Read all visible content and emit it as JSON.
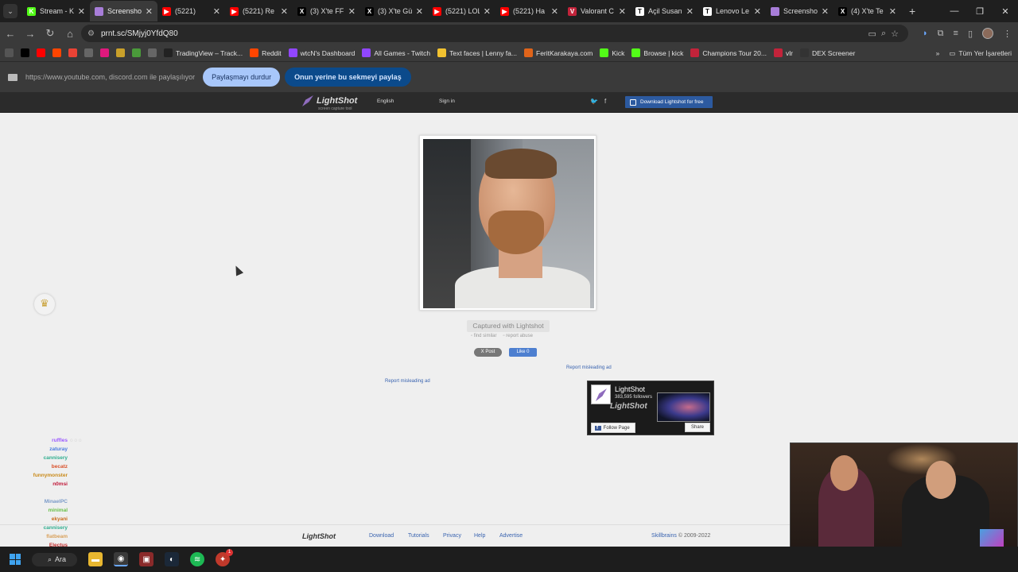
{
  "tabs": [
    {
      "label": "Stream - K",
      "icon_text": "K",
      "color": "#53fc18",
      "active": false
    },
    {
      "label": "Screensho",
      "icon_text": "",
      "color": "#a77dd8",
      "active": true
    },
    {
      "label": "(5221)",
      "icon_text": "▶",
      "color": "#ff0000",
      "active": false
    },
    {
      "label": "(5221) Re",
      "icon_text": "▶",
      "color": "#ff0000",
      "active": false
    },
    {
      "label": "(3) X'te FF",
      "icon_text": "X",
      "color": "#000000",
      "active": false
    },
    {
      "label": "(3) X'te Gü",
      "icon_text": "X",
      "color": "#000000",
      "active": false
    },
    {
      "label": "(5221) LOL",
      "icon_text": "▶",
      "color": "#ff0000",
      "active": false
    },
    {
      "label": "(5221) Ha",
      "icon_text": "▶",
      "color": "#ff0000",
      "active": false
    },
    {
      "label": "Valorant C",
      "icon_text": "V",
      "color": "#c2233a",
      "active": false
    },
    {
      "label": "Açil Susan",
      "icon_text": "T",
      "color": "#ffffff",
      "active": false
    },
    {
      "label": "Lenovo Le",
      "icon_text": "T",
      "color": "#ffffff",
      "active": false
    },
    {
      "label": "Screensho",
      "icon_text": "",
      "color": "#a77dd8",
      "active": false
    },
    {
      "label": "(4) X'te Te",
      "icon_text": "X",
      "color": "#000000",
      "active": false
    }
  ],
  "address": {
    "url": "prnt.sc/SMjyj0YfdQ80"
  },
  "bookmarks": [
    {
      "label": "",
      "icon": "apps-icon",
      "color": "#555"
    },
    {
      "label": "",
      "icon": "x-icon",
      "color": "#000"
    },
    {
      "label": "",
      "icon": "youtube-icon",
      "color": "#ff0000"
    },
    {
      "label": "",
      "icon": "reddit-icon",
      "color": "#ff4500"
    },
    {
      "label": "",
      "icon": "gmail-icon",
      "color": "#ea4335"
    },
    {
      "label": "",
      "icon": "globe-icon",
      "color": "#666"
    },
    {
      "label": "",
      "icon": "y-icon",
      "color": "#e0197d"
    },
    {
      "label": "",
      "icon": "g-icon",
      "color": "#c9a02a"
    },
    {
      "label": "",
      "icon": "frog-icon",
      "color": "#4a9a3a"
    },
    {
      "label": "",
      "icon": "globe-icon",
      "color": "#666"
    },
    {
      "label": "TradingView – Track...",
      "icon": "tradingview-icon",
      "color": "#222"
    },
    {
      "label": "Reddit",
      "icon": "reddit-icon",
      "color": "#ff4500"
    },
    {
      "label": "wtcN's Dashboard",
      "icon": "twitch-icon",
      "color": "#9146ff"
    },
    {
      "label": "All Games - Twitch",
      "icon": "twitch-icon",
      "color": "#9146ff"
    },
    {
      "label": "Text faces | Lenny fa...",
      "icon": "smile-icon",
      "color": "#f2c230"
    },
    {
      "label": "FeritKarakaya.com",
      "icon": "fk-icon",
      "color": "#e0641a"
    },
    {
      "label": "Kick",
      "icon": "kick-icon",
      "color": "#53fc18"
    },
    {
      "label": "Browse | kick",
      "icon": "kick-icon",
      "color": "#53fc18"
    },
    {
      "label": "Champions Tour 20...",
      "icon": "valorant-icon",
      "color": "#c2233a"
    },
    {
      "label": "vlr",
      "icon": "valorant-icon",
      "color": "#c2233a"
    },
    {
      "label": "DEX Screener",
      "icon": "dex-icon",
      "color": "#333"
    }
  ],
  "bookmarks_all": "Tüm Yer İşaretleri",
  "sharebar": {
    "text": "https://www.youtube.com, discord.com ile paylaşılıyor",
    "stop_button": "Paylaşmayı durdur",
    "share_tab_button": "Onun yerine bu sekmeyi paylaş"
  },
  "lightshot": {
    "logo": "LightShot",
    "tagline": "screen capture tool",
    "language": "English",
    "signin": "Sign in",
    "download_button": "Download Lightshot for free",
    "captured": "Captured with Lightshot",
    "find_similar": "find similar",
    "report_abuse": "report abuse",
    "post": "X Post",
    "like": "Like 0",
    "report_ad_1": "Report misleading ad",
    "report_ad_2": "Report misleading ad"
  },
  "fb_widget": {
    "title": "LightShot",
    "followers": "383,595 followers",
    "follow": "Follow Page",
    "share": "Share",
    "logo_text": "LightShot"
  },
  "footer": {
    "logo": "LightShot",
    "links": [
      "Download",
      "Tutorials",
      "Privacy",
      "Help",
      "Advertise"
    ],
    "company": "Skillbrains",
    "copyright": "© 2009-2022"
  },
  "chat": [
    {
      "user": "",
      "text": "",
      "color": "#3fbf4f"
    },
    {
      "user": "ruffles",
      "text": "o o o",
      "color": "#9b59ff"
    },
    {
      "user": "zaturay",
      "text": "",
      "color": "#4a7adf"
    },
    {
      "user": "cannisery",
      "text": "",
      "color": "#2fae8f"
    },
    {
      "user": "becatz",
      "text": "",
      "color": "#d9502a"
    },
    {
      "user": "funnymonster",
      "text": "",
      "color": "#c98a1a"
    },
    {
      "user": "n0msi",
      "text": "",
      "color": "#c01a3a"
    },
    {
      "user": "MinaelPC",
      "text": "",
      "color": "#7a9ac8"
    },
    {
      "user": "minimal",
      "text": "",
      "color": "#6ac04a"
    },
    {
      "user": "ekyani",
      "text": "",
      "color": "#c96a1a"
    },
    {
      "user": "cannisery",
      "text": "",
      "color": "#2fae8f"
    },
    {
      "user": "flatbeam",
      "text": "",
      "color": "#d8a05a"
    },
    {
      "user": "Electus",
      "text": "",
      "color": "#c02a2a"
    }
  ],
  "taskbar": {
    "search": "Ara"
  }
}
